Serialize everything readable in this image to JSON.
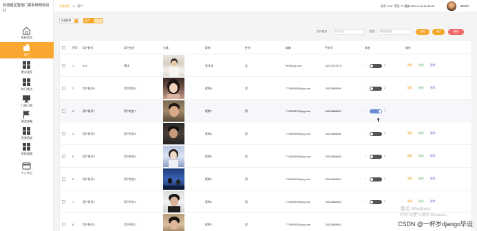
{
  "brand": {
    "title": "抚游曼区智能门票系统规划设计"
  },
  "sidebar": {
    "items": [
      {
        "label": "系统首页",
        "icon": "home-icon"
      },
      {
        "label": "用户",
        "icon": "user-icon",
        "active": true
      },
      {
        "label": "景点类型",
        "icon": "grid-icon"
      },
      {
        "label": "热门景点",
        "icon": "grid-icon"
      },
      {
        "label": "门票订购",
        "icon": "monitor-icon"
      },
      {
        "label": "旅游攻略",
        "icon": "flag-icon"
      },
      {
        "label": "资源回收",
        "icon": "grid-icon"
      },
      {
        "label": "系统管理",
        "icon": "grid-icon"
      },
      {
        "label": "个人中心",
        "icon": "id-card-icon"
      }
    ]
  },
  "topbar": {
    "crumb_home": "系统首页",
    "crumb_sep": "•••",
    "crumb_current": "用户",
    "weather": "北京  19.2° 多云  70 湿度  2024-4-15 11:32:50",
    "admin": "admin"
  },
  "toolbar": {
    "toggle1": "系统推荐",
    "toggle2": "用户"
  },
  "search": {
    "label_name": "用户姓名",
    "placeholder_name": "用户姓名",
    "label_gender": "性别",
    "placeholder_gender": "请选择性别",
    "query": "查询",
    "add": "添加",
    "delete": "删除"
  },
  "table": {
    "headers": [
      "序号",
      "用户账号",
      "用户姓名",
      "头像",
      "昵称",
      "性别",
      "邮箱",
      "手机号",
      "状态",
      "操作"
    ],
    "switch_left": "<",
    "switch_right": "Z",
    "actions": [
      "详情",
      "修改",
      "删除"
    ],
    "rows": [
      {
        "no": "1",
        "account": "333",
        "name": "落冰",
        "nick": "张冰冰",
        "gender": "女",
        "email": "991@qq.com",
        "phone": "13210187575",
        "status": false,
        "photo": "p1"
      },
      {
        "no": "2",
        "account": "用户账号8",
        "name": "用户姓名8",
        "nick": "昵称8",
        "gender": "男",
        "email": "773890008@qq.com",
        "phone": "13823888888",
        "status": false,
        "photo": "p2"
      },
      {
        "no": "3",
        "account": "用户账号7",
        "name": "用户姓名7",
        "nick": "昵称7",
        "gender": "男",
        "email": "773890007@qq.com",
        "phone": "13823888887",
        "status": true,
        "photo": "p3"
      },
      {
        "no": "4",
        "account": "用户账号6",
        "name": "用户姓名6",
        "nick": "昵称6",
        "gender": "男",
        "email": "773890006@qq.com",
        "phone": "13823888886",
        "status": false,
        "photo": "p4"
      },
      {
        "no": "5",
        "account": "用户账号5",
        "name": "用户姓名5",
        "nick": "昵称5",
        "gender": "男",
        "email": "773890005@qq.com",
        "phone": "13823888885",
        "status": false,
        "photo": "p5"
      },
      {
        "no": "6",
        "account": "用户账号4",
        "name": "用户姓名4",
        "nick": "昵称4",
        "gender": "男",
        "email": "773890004@qq.com",
        "phone": "13823888884",
        "status": false,
        "photo": "p6"
      },
      {
        "no": "7",
        "account": "用户账号3",
        "name": "用户姓名3",
        "nick": "昵称3",
        "gender": "男",
        "email": "773890003@qq.com",
        "phone": "13823888883",
        "status": false,
        "photo": "p7"
      },
      {
        "no": "8",
        "account": "用户账号2",
        "name": "用户姓名2",
        "nick": "昵称2",
        "gender": "男",
        "email": "773890002@qq.com",
        "phone": "13823888882",
        "status": false,
        "photo": "p8"
      }
    ]
  },
  "overlay": {
    "watermark_line1": "激活 Windows",
    "watermark_line2": "转到\"设置\"以激活 Windows。",
    "csdn": "CSDN @一杯岁django毕设"
  }
}
